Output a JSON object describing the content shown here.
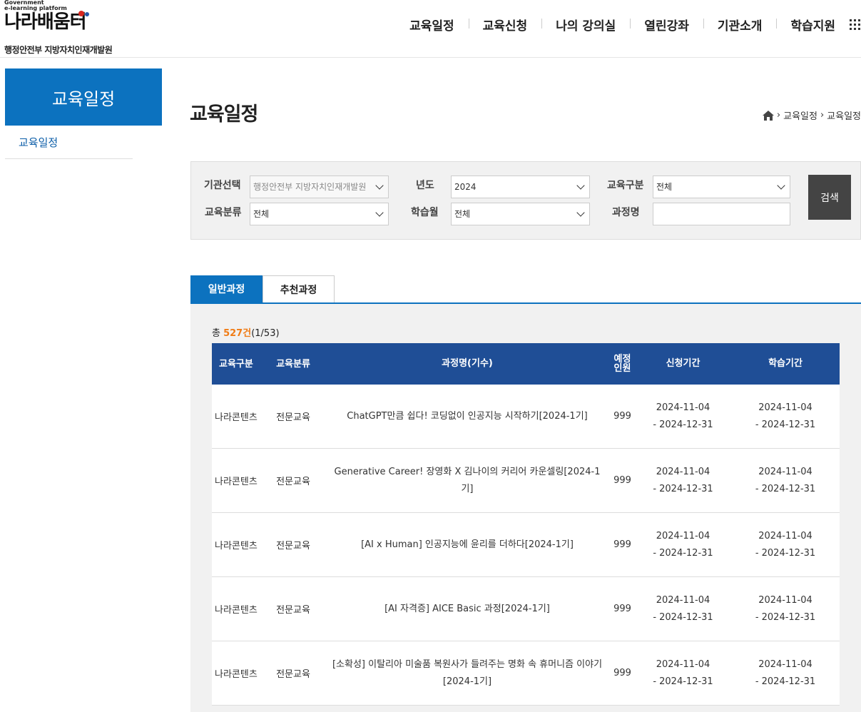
{
  "logo": {
    "small_line1": "Government",
    "small_line2": "e-learning platform",
    "main": "나라배움터",
    "sub": "행정안전부 지방자치인재개발원"
  },
  "gnb": {
    "items": [
      "교육일정",
      "교육신청",
      "나의 강의실",
      "열린강좌",
      "기관소개",
      "학습지원"
    ],
    "menu_icon": "grid-menu-icon"
  },
  "sidebar": {
    "title": "교육일정",
    "items": [
      {
        "label": "교육일정"
      }
    ]
  },
  "page": {
    "title": "교육일정",
    "breadcrumb": [
      "교육일정",
      "교육일정"
    ]
  },
  "search": {
    "org_label": "기관선택",
    "org_value": "행정안전부 지방자치인재개발원",
    "year_label": "년도",
    "year_value": "2024",
    "type_label": "교육구분",
    "type_value": "전체",
    "category_label": "교육분류",
    "category_value": "전체",
    "month_label": "학습월",
    "month_value": "전체",
    "course_label": "과정명",
    "course_value": "",
    "button": "검색"
  },
  "tabs": [
    {
      "label": "일반과정",
      "active": true
    },
    {
      "label": "추천과정",
      "active": false
    }
  ],
  "count": {
    "prefix": "총 ",
    "total": "527건",
    "pages": "(1/53)"
  },
  "table": {
    "headers": [
      "교육구분",
      "교육분류",
      "과정명(기수)",
      "예정인원",
      "신청기간",
      "학습기간"
    ],
    "rows": [
      {
        "type": "나라콘텐츠",
        "category": "전문교육",
        "course": "ChatGPT만큼 쉽다! 코딩없이 인공지능 시작하기[2024-1기]",
        "capacity": "999",
        "apply_start": "2024-11-04",
        "apply_end": "- 2024-12-31",
        "study_start": "2024-11-04",
        "study_end": "- 2024-12-31"
      },
      {
        "type": "나라콘텐츠",
        "category": "전문교육",
        "course": "Generative Career! 장영화 X 김나이의 커리어 카운셀링[2024-1기]",
        "capacity": "999",
        "apply_start": "2024-11-04",
        "apply_end": "- 2024-12-31",
        "study_start": "2024-11-04",
        "study_end": "- 2024-12-31"
      },
      {
        "type": "나라콘텐츠",
        "category": "전문교육",
        "course": "[AI x Human] 인공지능에 윤리를 더하다[2024-1기]",
        "capacity": "999",
        "apply_start": "2024-11-04",
        "apply_end": "- 2024-12-31",
        "study_start": "2024-11-04",
        "study_end": "- 2024-12-31"
      },
      {
        "type": "나라콘텐츠",
        "category": "전문교육",
        "course": "[AI 자격증] AICE Basic 과정[2024-1기]",
        "capacity": "999",
        "apply_start": "2024-11-04",
        "apply_end": "- 2024-12-31",
        "study_start": "2024-11-04",
        "study_end": "- 2024-12-31"
      },
      {
        "type": "나라콘텐츠",
        "category": "전문교육",
        "course": "[소확성] 이탈리아 미술품 복원사가 들려주는 명화 속 휴머니즘 이야기[2024-1기]",
        "capacity": "999",
        "apply_start": "2024-11-04",
        "apply_end": "- 2024-12-31",
        "study_start": "2024-11-04",
        "study_end": "- 2024-12-31"
      }
    ]
  },
  "colors": {
    "primary": "#0c72bf",
    "table_header": "#1f4e96",
    "count_accent": "#f07c16",
    "search_button": "#444444"
  }
}
